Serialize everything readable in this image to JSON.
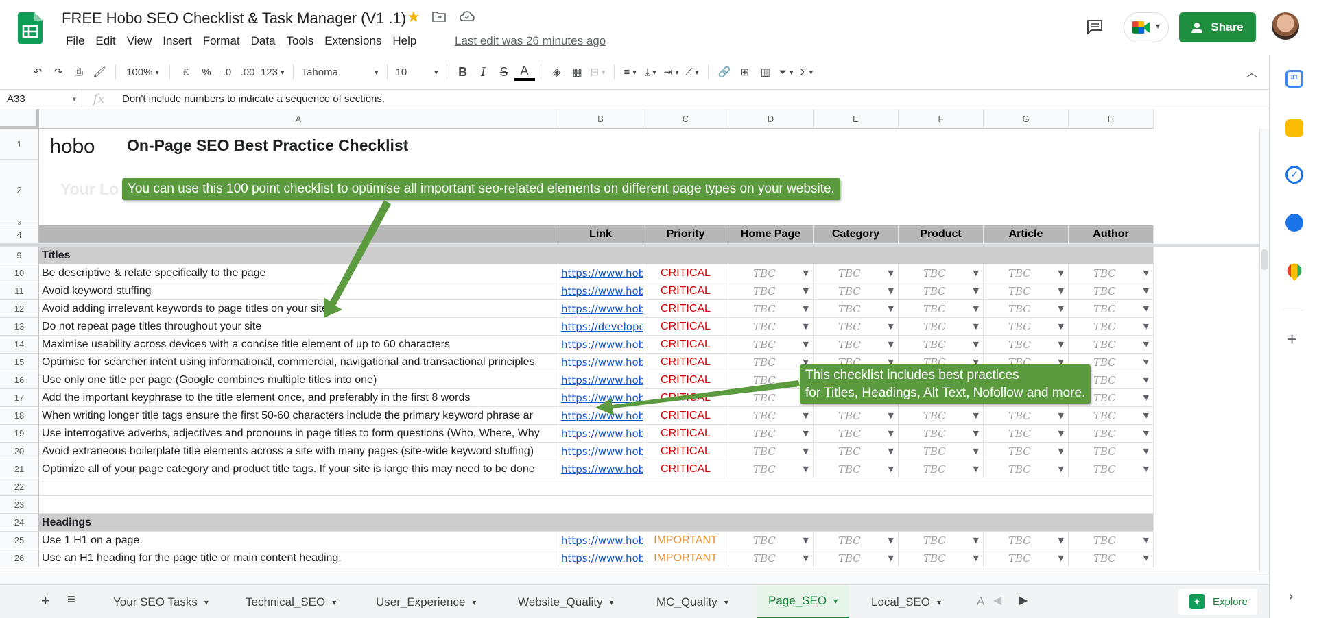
{
  "doc": {
    "title": "FREE Hobo SEO Checklist & Task Manager (V1 .1)",
    "last_edit": "Last edit was 26 minutes ago",
    "share_label": "Share"
  },
  "menu": [
    "File",
    "Edit",
    "View",
    "Insert",
    "Format",
    "Data",
    "Tools",
    "Extensions",
    "Help"
  ],
  "toolbar": {
    "zoom": "100%",
    "currency": "£",
    "percent": "%",
    "dec_less": ".0",
    "dec_more": ".00",
    "number_format": "123",
    "font": "Tahoma",
    "font_size": "10",
    "bold": "B",
    "italic": "I",
    "strike": "S",
    "text_color": "A"
  },
  "formula_bar": {
    "cell_ref": "A33",
    "fx": "fx",
    "content": "Don't include numbers to indicate a sequence of sections."
  },
  "columns": [
    "A",
    "B",
    "C",
    "D",
    "E",
    "F",
    "G",
    "H"
  ],
  "sheet": {
    "brand": "hobo",
    "heading": "On-Page SEO Best Practice Checklist",
    "your_logo": "Your Lo",
    "header_row": {
      "link": "Link",
      "priority": "Priority",
      "home": "Home Page",
      "category": "Category",
      "product": "Product",
      "article": "Article",
      "author": "Author"
    },
    "sections": {
      "titles": "Titles",
      "headings": "Headings"
    },
    "tbc": "TBC",
    "title_rows": [
      {
        "num": "10",
        "text": "Be descriptive & relate specifically to the page",
        "link": "https://www.hob",
        "priority": "CRITICAL"
      },
      {
        "num": "11",
        "text": "Avoid keyword stuffing",
        "link": "https://www.hob",
        "priority": "CRITICAL"
      },
      {
        "num": "12",
        "text": "Avoid adding irrelevant keywords to page titles on your site",
        "link": "https://www.hob",
        "priority": "CRITICAL"
      },
      {
        "num": "13",
        "text": "Do not repeat page titles throughout your site",
        "link": "https://develope",
        "priority": "CRITICAL"
      },
      {
        "num": "14",
        "text": "Maximise usability across devices with a concise title element of up to 60 characters",
        "link": "https://www.hob",
        "priority": "CRITICAL"
      },
      {
        "num": "15",
        "text": "Optimise for searcher intent using informational, commercial, navigational and transactional principles",
        "link": "https://www.hob",
        "priority": "CRITICAL"
      },
      {
        "num": "16",
        "text": "Use only one title per page (Google combines multiple titles into one)",
        "link": "https://www.hob",
        "priority": "CRITICAL"
      },
      {
        "num": "17",
        "text": "Add the important keyphrase to the title element once, and preferably in the first 8 words",
        "link": "https://www.hob",
        "priority": "CRITICAL"
      },
      {
        "num": "18",
        "text": "When writing longer title tags ensure the first 50-60 characters include the primary keyword phrase ar",
        "link": "https://www.hob",
        "priority": "CRITICAL"
      },
      {
        "num": "19",
        "text": "Use interrogative adverbs, adjectives and pronouns in page titles to form questions (Who, Where, Why",
        "link": "https://www.hob",
        "priority": "CRITICAL"
      },
      {
        "num": "20",
        "text": "Avoid extraneous boilerplate title elements across a site with many pages (site-wide keyword stuffing)",
        "link": "https://www.hob",
        "priority": "CRITICAL"
      },
      {
        "num": "21",
        "text": "Optimize all of your page category and product title tags. If your site is large this may need to be done",
        "link": "https://www.hob",
        "priority": "CRITICAL"
      }
    ],
    "heading_rows": [
      {
        "num": "25",
        "text": "Use 1 H1 on a page.",
        "link": "https://www.hob",
        "priority": "IMPORTANT"
      },
      {
        "num": "26",
        "text": "Use an H1 heading for the page title or main content heading.",
        "link": "https://www.hob",
        "priority": "IMPORTANT"
      }
    ],
    "row_numbers": {
      "r1": "1",
      "r2": "2",
      "r3": "3",
      "r4": "4",
      "r9": "9",
      "r22": "22",
      "r23": "23",
      "r24": "24"
    }
  },
  "callouts": {
    "top": "You can use this 100 point checklist to optimise all important seo-related elements on different page types on your website.",
    "mid_line1": "This checklist includes best practices",
    "mid_line2": "for Titles, Headings, Alt Text, Nofollow and more."
  },
  "tabs": [
    "Your SEO Tasks",
    "Technical_SEO",
    "User_Experience",
    "Website_Quality",
    "MC_Quality",
    "Page_SEO",
    "Local_SEO",
    "A"
  ],
  "active_tab": "Page_SEO",
  "explore_label": "Explore",
  "colors": {
    "share_green": "#1e8e3e",
    "critical_red": "#cc0000",
    "important_orange": "#e69138",
    "callout_green": "#5b9a3f",
    "band_grey": "#b7b7b7"
  }
}
